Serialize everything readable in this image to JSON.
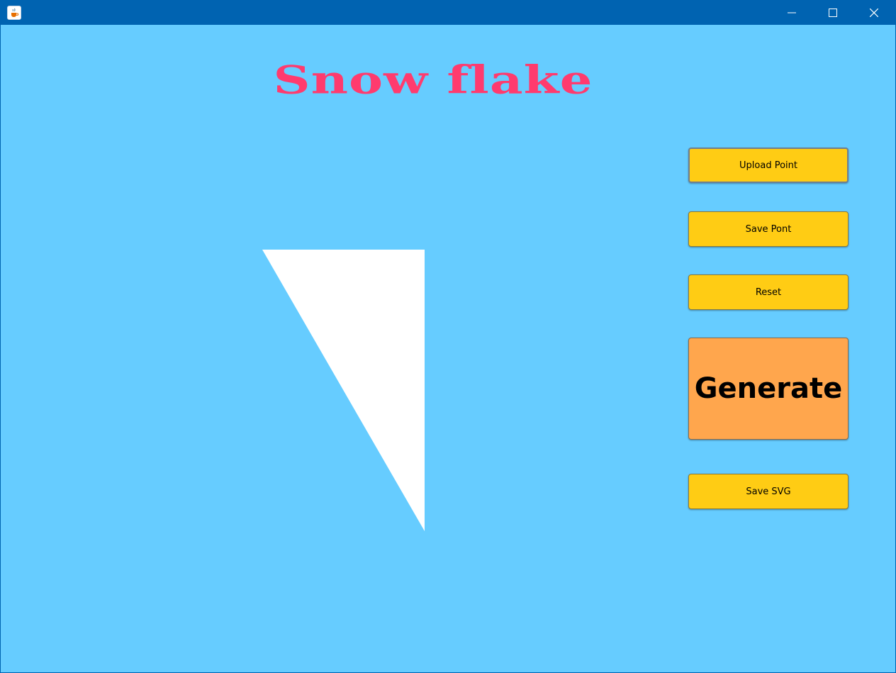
{
  "window": {
    "title_icon": "java-cup-icon",
    "controls": {
      "minimize_icon": "minimize-icon",
      "maximize_icon": "maximize-icon",
      "close_icon": "close-icon"
    }
  },
  "header": {
    "title": "Snow flake"
  },
  "buttons": {
    "upload_point": "Upload Point",
    "save_point": "Save Pont",
    "reset": "Reset",
    "generate": "Generate",
    "save_svg": "Save SVG"
  },
  "colors": {
    "titlebar": "#0063b1",
    "background": "#66ccff",
    "title_text": "#ff3b6e",
    "button": "#ffcc14",
    "generate_button": "#ffa64d",
    "shape_fill": "#ffffff"
  }
}
